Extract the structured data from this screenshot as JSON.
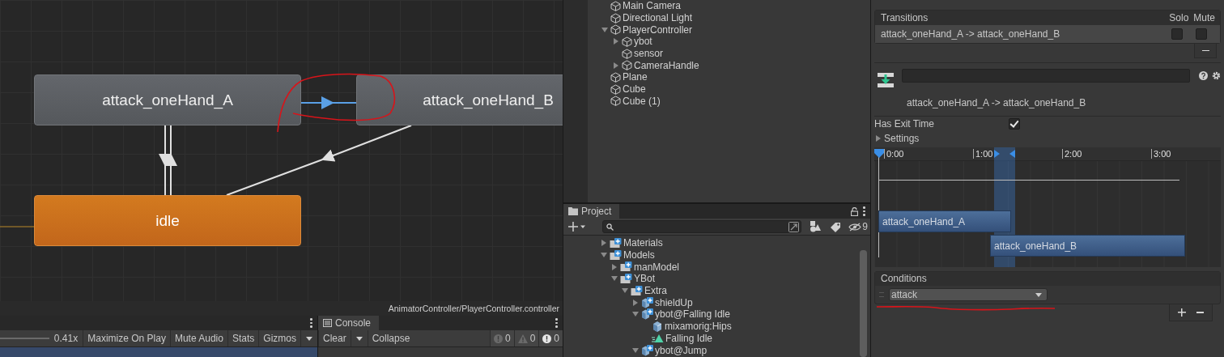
{
  "animator": {
    "states": [
      {
        "name": "attack_oneHand_A",
        "kind": "state"
      },
      {
        "name": "attack_oneHand_B",
        "kind": "state"
      },
      {
        "name": "idle",
        "kind": "default"
      }
    ],
    "path": "AnimatorController/PlayerController.controller"
  },
  "game_view": {
    "scale": "0.41x",
    "buttons": [
      {
        "label": "Maximize On Play",
        "kind": "toggle"
      },
      {
        "label": "Mute Audio",
        "kind": "toggle"
      },
      {
        "label": "Stats",
        "kind": "toggle"
      },
      {
        "label": "Gizmos",
        "kind": "split"
      }
    ]
  },
  "console": {
    "tab": "Console",
    "buttons": [
      {
        "label": "Clear",
        "kind": "split"
      },
      {
        "label": "Collapse",
        "kind": "toggle"
      }
    ],
    "counts": [
      {
        "kind": "info",
        "count": "0"
      },
      {
        "kind": "warning",
        "count": "0"
      },
      {
        "kind": "error",
        "count": "0"
      }
    ]
  },
  "hierarchy": {
    "items": [
      {
        "name": "Main Camera"
      },
      {
        "name": "Directional Light"
      },
      {
        "name": "PlayerController",
        "expanded": true,
        "children": [
          {
            "name": "ybot",
            "expanded": false
          },
          {
            "name": "sensor"
          },
          {
            "name": "CameraHandle",
            "expanded": false
          }
        ]
      },
      {
        "name": "Plane"
      },
      {
        "name": "Cube"
      },
      {
        "name": "Cube (1)"
      }
    ]
  },
  "project": {
    "tab": "Project",
    "hidden_count": "9",
    "items": [
      {
        "name": "Materials",
        "kind": "folder",
        "expanded": false
      },
      {
        "name": "Models",
        "kind": "folder",
        "expanded": true,
        "children": [
          {
            "name": "manModel",
            "kind": "folder",
            "expanded": false
          },
          {
            "name": "YBot",
            "kind": "folder",
            "expanded": true,
            "children": [
              {
                "name": "Extra",
                "kind": "folder",
                "expanded": true,
                "children": [
                  {
                    "name": "shieldUp",
                    "kind": "model",
                    "expanded": false
                  },
                  {
                    "name": "ybot@Falling Idle",
                    "kind": "model",
                    "expanded": true,
                    "children": [
                      {
                        "name": "mixamorig:Hips",
                        "kind": "mesh"
                      },
                      {
                        "name": "Falling Idle",
                        "kind": "clip"
                      }
                    ]
                  },
                  {
                    "name": "ybot@Jump",
                    "kind": "model",
                    "expanded": true
                  }
                ]
              }
            ]
          }
        ]
      }
    ]
  },
  "inspector": {
    "transitions": {
      "title": "Transitions",
      "columns": [
        "Solo",
        "Mute"
      ],
      "rows": [
        {
          "name": "attack_oneHand_A -> attack_oneHand_B",
          "solo": false,
          "mute": false
        }
      ]
    },
    "title": "attack_oneHand_A -> attack_oneHand_B",
    "has_exit_time": {
      "label": "Has Exit Time",
      "checked": true
    },
    "settings": {
      "label": "Settings",
      "expanded": false
    },
    "timeline": {
      "ticks": [
        "0:00",
        "1:00",
        "2:00",
        "3:00"
      ],
      "clips": [
        {
          "name": "attack_oneHand_A"
        },
        {
          "name": "attack_oneHand_B"
        }
      ]
    },
    "conditions": {
      "title": "Conditions",
      "items": [
        {
          "parameter": "attack"
        }
      ]
    }
  }
}
